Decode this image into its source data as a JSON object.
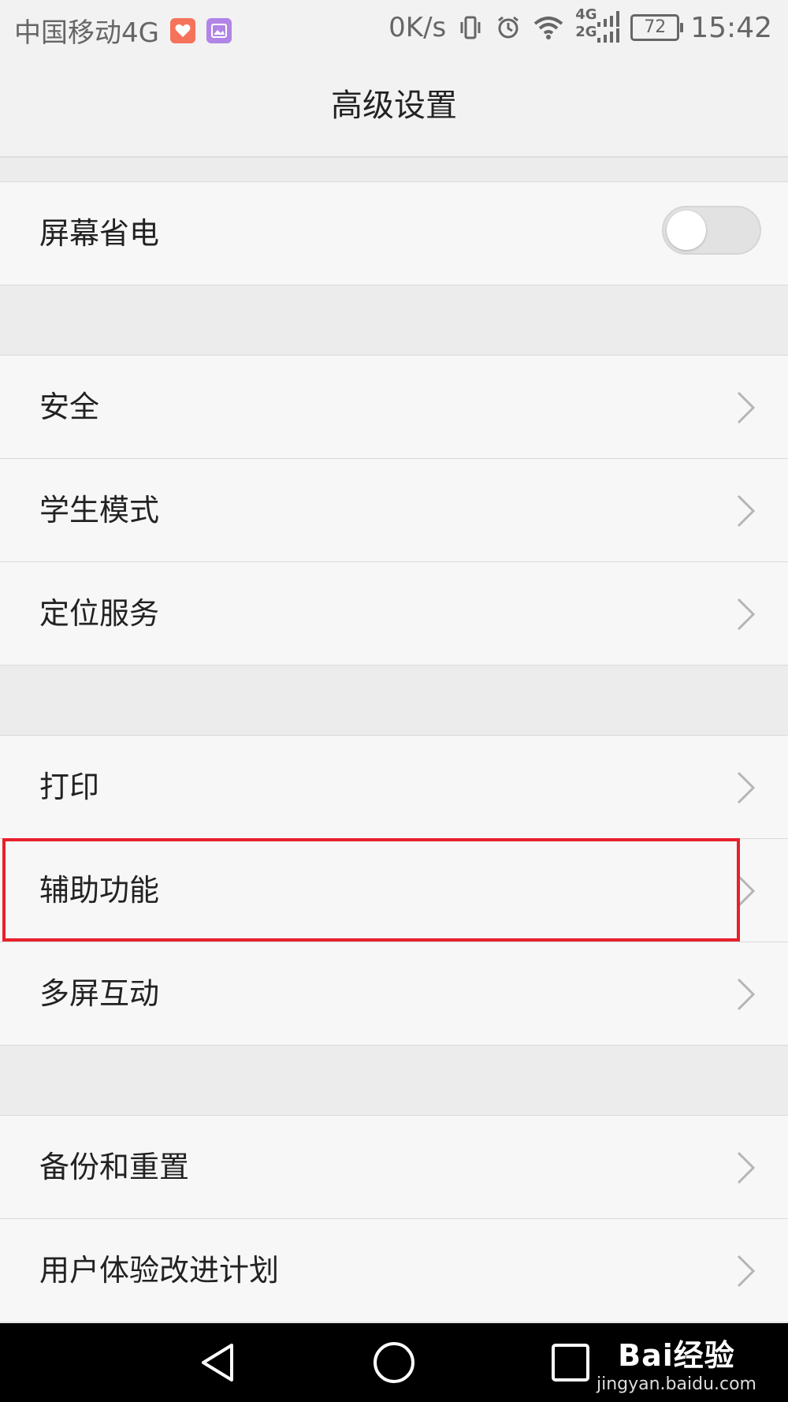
{
  "status_bar": {
    "carrier": "中国移动4G",
    "speed": "0K/s",
    "network_top": "4G",
    "network_bottom": "2G",
    "battery": "72",
    "time": "15:42",
    "icons": [
      "health-app-icon",
      "gallery-app-icon",
      "vibrate-icon",
      "alarm-icon",
      "wifi-icon",
      "signal-icon",
      "battery-icon"
    ]
  },
  "header": {
    "title": "高级设置"
  },
  "rows": {
    "screen_power_saving": {
      "label": "屏幕省电",
      "toggle_on": false
    },
    "security": {
      "label": "安全"
    },
    "student_mode": {
      "label": "学生模式"
    },
    "location_services": {
      "label": "定位服务"
    },
    "print": {
      "label": "打印"
    },
    "accessibility": {
      "label": "辅助功能"
    },
    "multi_screen": {
      "label": "多屏互动"
    },
    "backup_reset": {
      "label": "备份和重置"
    },
    "user_experience": {
      "label": "用户体验改进计划"
    }
  },
  "highlight": {
    "color": "#e8202a",
    "target": "accessibility"
  },
  "watermark": {
    "brand": "Bai经验",
    "url": "jingyan.baidu.com"
  },
  "colors": {
    "background": "#f7f7f7",
    "section_gap": "#ececec",
    "navbar": "#000000"
  }
}
